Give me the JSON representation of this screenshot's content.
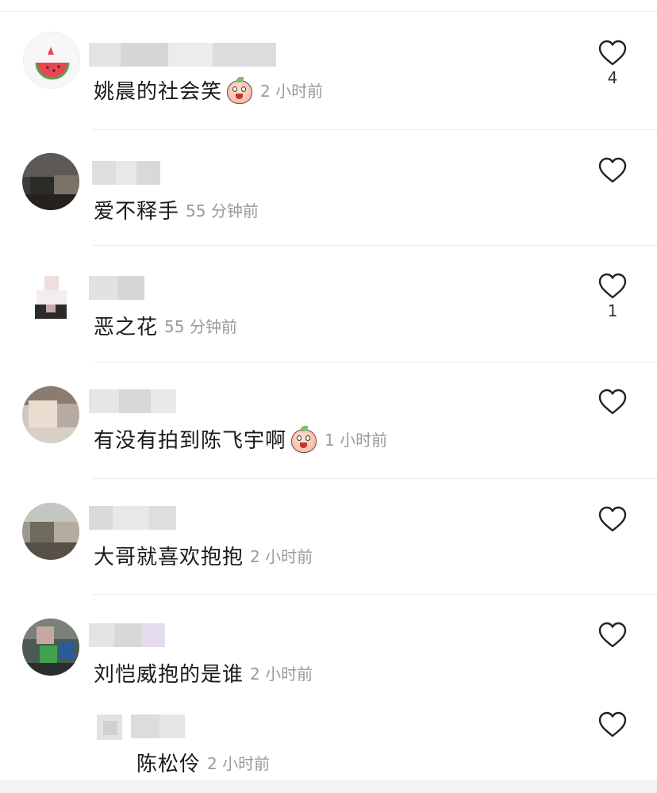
{
  "comments": [
    {
      "text": "姚晨的社会笑",
      "time": "2 小时前",
      "like_count": "4",
      "has_emoji": true
    },
    {
      "text": "爱不释手",
      "time": "55 分钟前",
      "like_count": "",
      "has_emoji": false
    },
    {
      "text": "恶之花",
      "time": "55 分钟前",
      "like_count": "1",
      "has_emoji": false
    },
    {
      "text": "有没有拍到陈飞宇啊",
      "time": "1 小时前",
      "like_count": "",
      "has_emoji": true
    },
    {
      "text": "大哥就喜欢抱抱",
      "time": "2 小时前",
      "like_count": "",
      "has_emoji": false
    },
    {
      "text": "刘恺威抱的是谁",
      "time": "2 小时前",
      "like_count": "",
      "has_emoji": false
    }
  ],
  "reply": {
    "text": "陈松伶",
    "time": "2 小时前",
    "like_count": ""
  },
  "icons": {
    "like": "heart-outline-icon",
    "emoji": "peach-emoji-icon"
  },
  "colors": {
    "text": "#1a1a1a",
    "time": "#9a9a9a",
    "divider": "#ececec"
  }
}
